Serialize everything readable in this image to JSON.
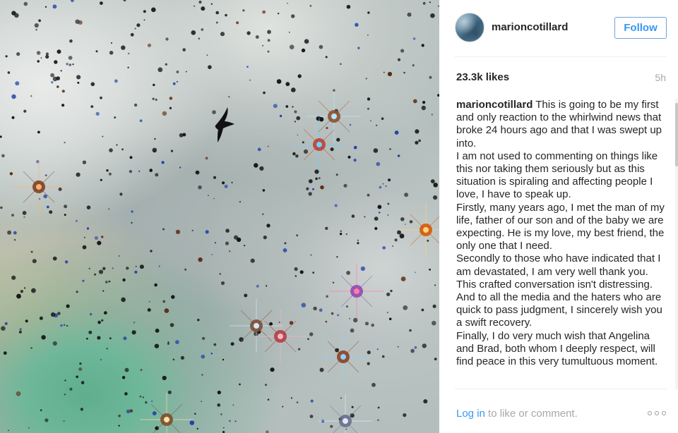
{
  "post": {
    "image_alt": "Starry sky with a bird silhouette",
    "image_icon": "bird-silhouette-icon"
  },
  "header": {
    "username": "marioncotillard",
    "follow_label": "Follow",
    "accent_color": "#3897f0"
  },
  "stats": {
    "likes": "23.3k likes",
    "time_ago": "5h"
  },
  "caption": {
    "username": "marioncotillard",
    "paragraphs": [
      "This is going to be my first and only reaction to the whirlwind news that broke 24 hours ago and that I was swept up into.",
      "I am not used to commenting on things like this nor taking them seriously but as this situation is spiraling and affecting people I love, I have to speak up.",
      "Firstly, many years ago, I met the man of my life, father of our son and of the baby we are expecting. He is my love, my best friend, the only one that I need.",
      "Secondly to those who have indicated that I am devastated, I am very well thank you. This crafted conversation isn't distressing.",
      "And to all the media and the haters who are quick to pass judgment, I sincerely wish you a swift recovery.",
      "Finally, I do very much wish that Angelina and Brad, both whom I deeply respect, will find peace in this very tumultuous moment."
    ]
  },
  "footer": {
    "login_label": "Log in",
    "login_suffix": " to like or comment.",
    "more_icon": "more-options-icon"
  }
}
